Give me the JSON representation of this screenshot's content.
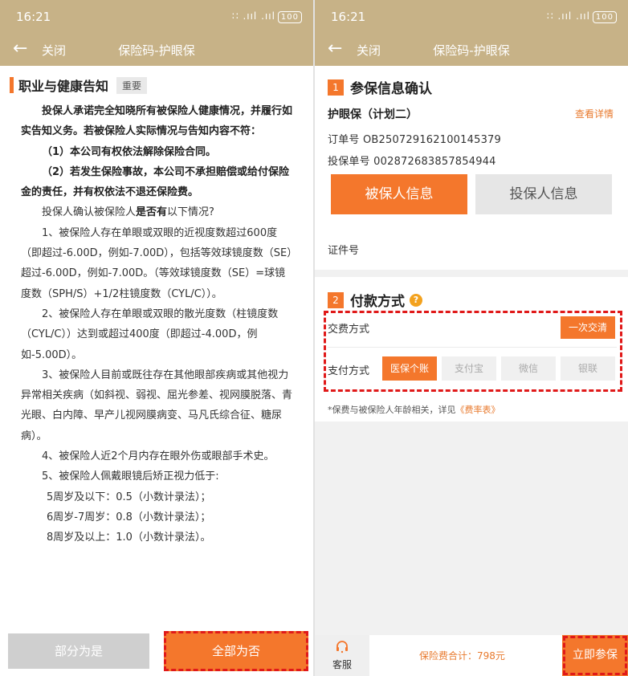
{
  "status": {
    "time": "16:21",
    "signal": "∷ .ııl .ııl",
    "battery": "100"
  },
  "nav": {
    "back_icon": "arrow-left-icon",
    "close_label": "关闭",
    "title": "保险码-护眼保"
  },
  "left": {
    "heading": "职业与健康告知",
    "tag": "重要",
    "para1": "投保人承诺完全知晓所有被保险人健康情况，并履行如实告知义务。若被保险人实际情况与告知内容不符：",
    "para2": "（1）本公司有权依法解除保险合同。",
    "para3": "（2）若发生保险事故，本公司不承担赔偿或给付保险金的责任，并有权依法不退还保险费。",
    "para4_pre": "投保人确认被保险人",
    "para4_bold": "是否有",
    "para4_post": "以下情况?",
    "item1": "1、被保险人存在单眼或双眼的近视度数超过600度（即超过-6.00D，例如-7.00D），包括等效球镜度数（SE）超过-6.00D，例如-7.00D。（等效球镜度数（SE）=球镜度数（SPH/S）+1/2柱镜度数（CYL/C））。",
    "item2": "2、被保险人存在单眼或双眼的散光度数（柱镜度数（CYL/C））达到或超过400度（即超过-4.00D，例如-5.00D）。",
    "item3": "3、被保险人目前或既往存在其他眼部疾病或其他视力异常相关疾病（如斜视、弱视、屈光参差、视网膜脱落、青光眼、白内障、早产儿视网膜病变、马凡氏综合征、糖尿病）。",
    "item4": "4、被保险人近2个月内存在眼外伤或眼部手术史。",
    "item5": "5、被保险人佩戴眼镜后矫正视力低于:",
    "sub1": "5周岁及以下：0.5（小数计录法）；",
    "sub2": "6周岁-7周岁：0.8（小数计录法）；",
    "sub3": "8周岁及以上：1.0（小数计录法）。",
    "btn_partial": "部分为是",
    "btn_all_no": "全部为否"
  },
  "right": {
    "sec1_num": "1",
    "sec1_title": "参保信息确认",
    "plan": "护眼保（计划二）",
    "detail_link": "查看详情",
    "order_label": "订单号",
    "order_no": "OB250729162100145379",
    "policy_label": "投保单号",
    "policy_no": "002872683857854944",
    "tab_insured": "被保人信息",
    "tab_applicant": "投保人信息",
    "id_label": "证件号",
    "sec2_num": "2",
    "sec2_title": "付款方式",
    "help": "?",
    "fee_label": "交费方式",
    "fee_btn": "一次交清",
    "pay_label": "支付方式",
    "pay_options": [
      "医保个账",
      "支付宝",
      "微信",
      "银联"
    ],
    "note_pre": "*保费与被保险人年龄相关，详见",
    "note_link": "《费率表》",
    "service": "客服",
    "total": "保险费合计：798元",
    "join": "立即参保"
  },
  "colors": {
    "header": "#c7b287",
    "accent": "#f4772c",
    "highlight": "#e01919"
  }
}
